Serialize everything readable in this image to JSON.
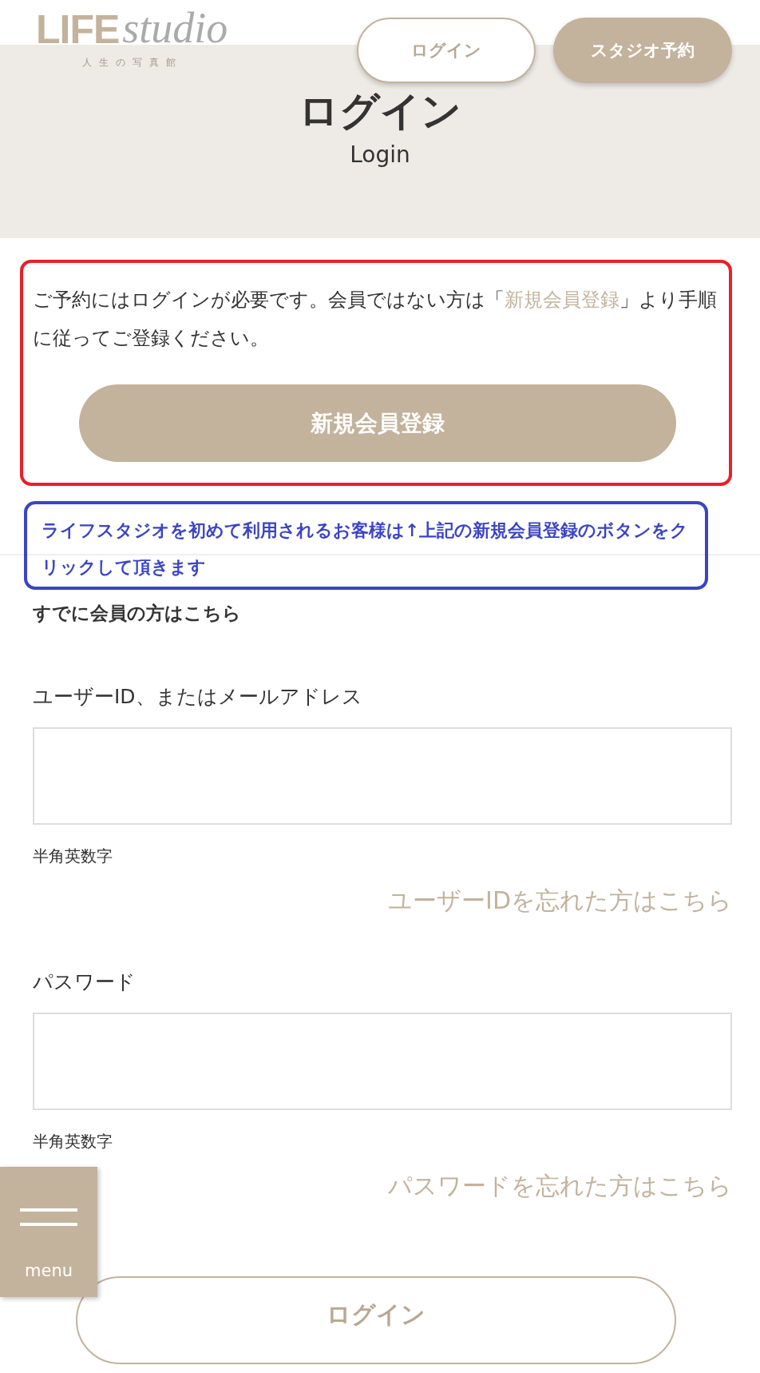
{
  "logo": {
    "primary": "LIFE",
    "script": "studio",
    "tagline": "人生の写真館"
  },
  "header_buttons": [
    {
      "label": "ログイン",
      "kind": "outline"
    },
    {
      "label": "スタジオ予約",
      "kind": "filled"
    }
  ],
  "page_title": "ログイン",
  "page_subtitle": "Login",
  "notice": {
    "text_before": "ご予約にはログインが必要です。会員ではない方は「",
    "link": "新規会員登録",
    "text_after": "」より手順に従ってご登録ください。",
    "button": "新規会員登録"
  },
  "annotation_note": "ライフスタジオを初めて利用されるお客様は↑上記の新規会員登録のボタンをクリックして頂きます",
  "member_heading": "すでに会員の方はこちら",
  "fields": [
    {
      "label": "ユーザーID、またはメールアドレス",
      "hint": "半角英数字",
      "forgot_link": "ユーザーIDを忘れた方はこちら"
    },
    {
      "label": "パスワード",
      "hint": "半角英数字",
      "forgot_link": "パスワードを忘れた方はこちら"
    }
  ],
  "menu_button": {
    "label": "menu"
  },
  "login_button": "ログイン"
}
